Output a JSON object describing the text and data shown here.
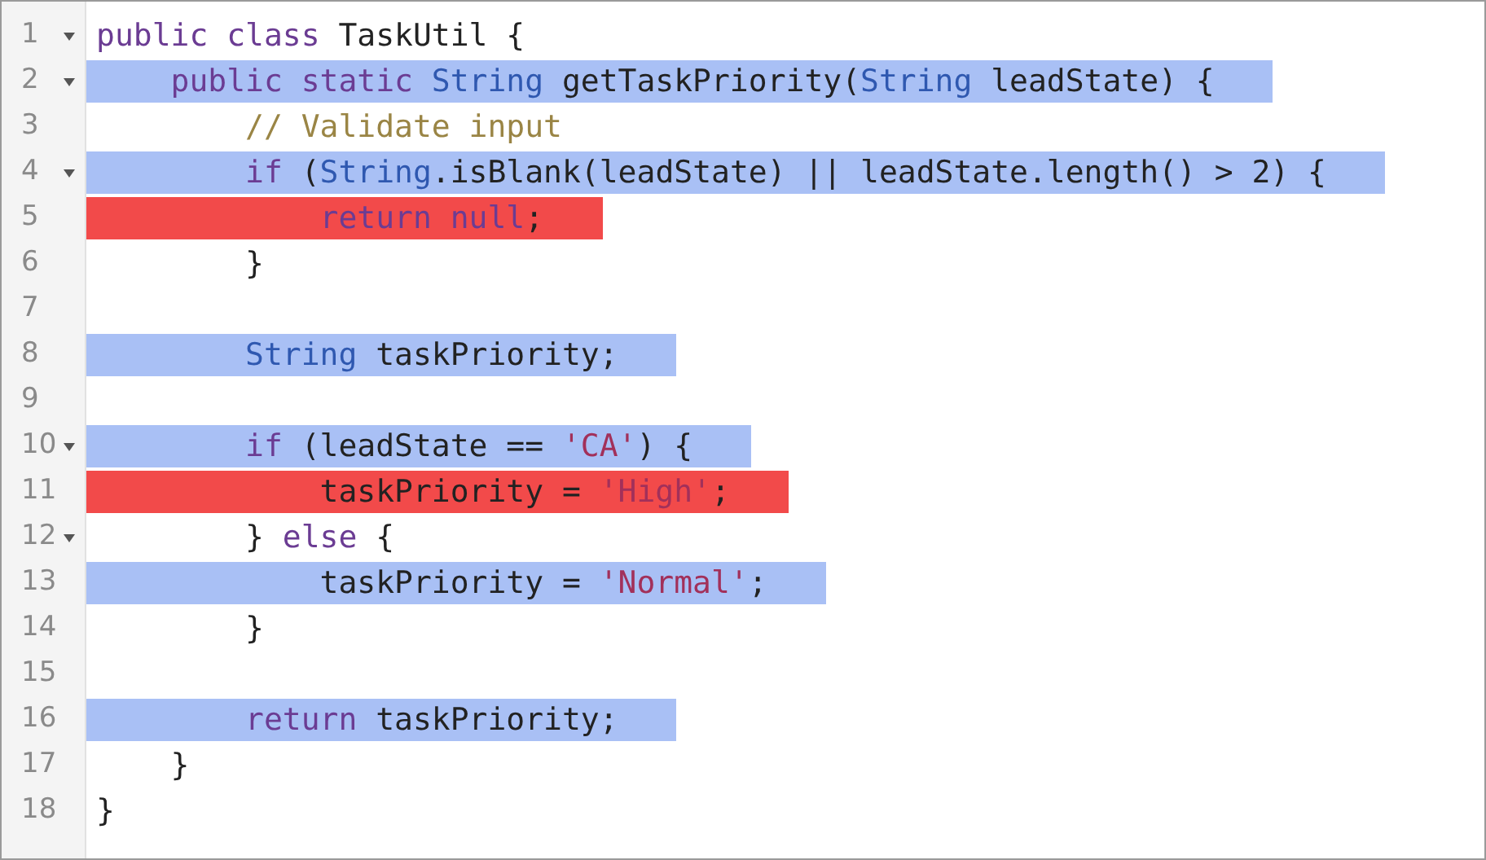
{
  "editor": {
    "lines": [
      {
        "number": "1",
        "foldable": true,
        "tokens": [
          {
            "kind": "keyword",
            "text": "public"
          },
          {
            "kind": "keyword",
            "text": " class"
          },
          {
            "kind": "plain",
            "text": " TaskUtil {"
          }
        ]
      },
      {
        "number": "2",
        "foldable": true,
        "color": "#a9c0f5",
        "tokens": [
          {
            "kind": "keyword",
            "text": "    public"
          },
          {
            "kind": "keyword",
            "text": " static"
          },
          {
            "kind": "type",
            "text": " String"
          },
          {
            "kind": "plain",
            "text": " getTaskPriority("
          },
          {
            "kind": "type",
            "text": "String"
          },
          {
            "kind": "plain",
            "text": " leadState) {"
          }
        ]
      },
      {
        "number": "3",
        "foldable": false,
        "tokens": [
          {
            "kind": "comment",
            "text": "        // Validate input"
          }
        ]
      },
      {
        "number": "4",
        "foldable": true,
        "color": "#a9c0f5",
        "tokens": [
          {
            "kind": "keyword",
            "text": "        if"
          },
          {
            "kind": "plain",
            "text": " ("
          },
          {
            "kind": "type",
            "text": "String"
          },
          {
            "kind": "plain",
            "text": ".isBlank(leadState) || leadState.length() > 2) {"
          }
        ]
      },
      {
        "number": "5",
        "foldable": false,
        "color": "#f24a4a",
        "tokens": [
          {
            "kind": "keyword",
            "text": "            return"
          },
          {
            "kind": "keyword",
            "text": " null"
          },
          {
            "kind": "plain",
            "text": ";"
          }
        ]
      },
      {
        "number": "6",
        "foldable": false,
        "tokens": [
          {
            "kind": "plain",
            "text": "        }"
          }
        ]
      },
      {
        "number": "7",
        "foldable": false
      },
      {
        "number": "8",
        "foldable": false,
        "color": "#a9c0f5",
        "tokens": [
          {
            "kind": "type",
            "text": "        String"
          },
          {
            "kind": "plain",
            "text": " taskPriority;"
          }
        ]
      },
      {
        "number": "9",
        "foldable": false
      },
      {
        "number": "10",
        "foldable": true,
        "color": "#a9c0f5",
        "tokens": [
          {
            "kind": "keyword",
            "text": "        if"
          },
          {
            "kind": "plain",
            "text": " (leadState == "
          },
          {
            "kind": "string",
            "text": "'CA'"
          },
          {
            "kind": "plain",
            "text": ") {"
          }
        ]
      },
      {
        "number": "11",
        "foldable": false,
        "color": "#f24a4a",
        "tokens": [
          {
            "kind": "plain",
            "text": "            taskPriority = "
          },
          {
            "kind": "string",
            "text": "'High'"
          },
          {
            "kind": "plain",
            "text": ";"
          }
        ]
      },
      {
        "number": "12",
        "foldable": true,
        "tokens": [
          {
            "kind": "plain",
            "text": "        }"
          },
          {
            "kind": "keyword",
            "text": " else"
          },
          {
            "kind": "plain",
            "text": " {"
          }
        ]
      },
      {
        "number": "13",
        "foldable": false,
        "color": "#a9c0f5",
        "tokens": [
          {
            "kind": "plain",
            "text": "            taskPriority = "
          },
          {
            "kind": "string",
            "text": "'Normal'"
          },
          {
            "kind": "plain",
            "text": ";"
          }
        ]
      },
      {
        "number": "14",
        "foldable": false,
        "tokens": [
          {
            "kind": "plain",
            "text": "        }"
          }
        ]
      },
      {
        "number": "15",
        "foldable": false
      },
      {
        "number": "16",
        "foldable": false,
        "color": "#a9c0f5",
        "tokens": [
          {
            "kind": "keyword",
            "text": "        return"
          },
          {
            "kind": "plain",
            "text": " taskPriority;"
          }
        ]
      },
      {
        "number": "17",
        "foldable": false,
        "tokens": [
          {
            "kind": "plain",
            "text": "    }"
          }
        ]
      },
      {
        "number": "18",
        "foldable": false,
        "tokens": [
          {
            "kind": "plain",
            "text": "}"
          }
        ]
      }
    ]
  }
}
